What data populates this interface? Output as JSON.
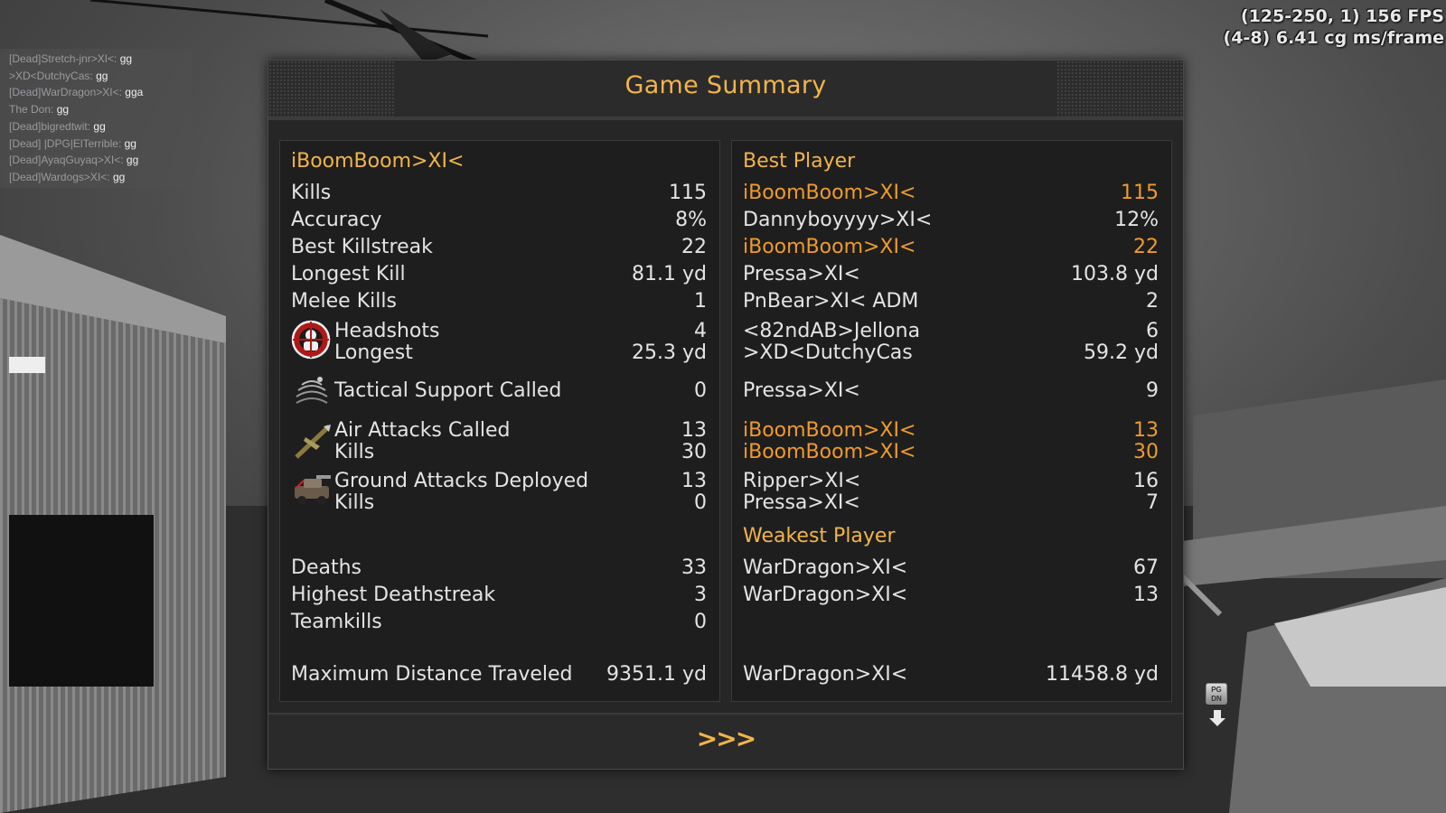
{
  "chat": [
    {
      "prefix": "[Dead]Stretch-jnr>XI<:",
      "msg": "gg"
    },
    {
      "prefix": ">XD<DutchyCas:",
      "msg": "gg"
    },
    {
      "prefix": "[Dead]WarDragon>XI<:",
      "msg": "gga"
    },
    {
      "prefix": "The Don:",
      "msg": "gg"
    },
    {
      "prefix": "[Dead]bigredtwit:",
      "msg": "gg"
    },
    {
      "prefix": "[Dead] |DPG|ElTerrible:",
      "msg": "gg"
    },
    {
      "prefix": "[Dead]AyaqGuyaq>XI<:",
      "msg": "gg"
    },
    {
      "prefix": "[Dead]Wardogs>XI<:",
      "msg": "gg"
    }
  ],
  "perf": {
    "line1": "(125-250, 1) 156 FPS",
    "line2": "(4-8) 6.41 cg ms/frame"
  },
  "hint": {
    "key": "PG DN",
    "icon": "down-arrow-icon"
  },
  "dialog": {
    "title": "Game Summary",
    "next_label": ">>>",
    "left": {
      "player": "iBoomBoom>XI<",
      "kills": {
        "label": "Kills",
        "value": "115"
      },
      "accuracy": {
        "label": "Accuracy",
        "value": "8%"
      },
      "best_killstreak": {
        "label": "Best Killstreak",
        "value": "22"
      },
      "longest_kill": {
        "label": "Longest Kill",
        "value": "81.1 yd"
      },
      "melee": {
        "label": "Melee Kills",
        "value": "1"
      },
      "headshots": {
        "label": "Headshots",
        "value": "4"
      },
      "headshot_longest": {
        "label": "Longest",
        "value": "25.3 yd"
      },
      "tactical": {
        "label": "Tactical Support Called",
        "value": "0"
      },
      "air": {
        "label": "Air Attacks Called",
        "value": "13"
      },
      "air_kills": {
        "label": "Kills",
        "value": "30"
      },
      "ground": {
        "label": "Ground Attacks Deployed",
        "value": "13"
      },
      "ground_kills": {
        "label": "Kills",
        "value": "0"
      },
      "deaths": {
        "label": "Deaths",
        "value": "33"
      },
      "deathstreak": {
        "label": "Highest Deathstreak",
        "value": "3"
      },
      "teamkills": {
        "label": "Teamkills",
        "value": "0"
      },
      "distance": {
        "label": "Maximum Distance Traveled",
        "value": "9351.1 yd"
      }
    },
    "right": {
      "best_header": "Best Player",
      "weakest_header": "Weakest Player",
      "kills": {
        "name": "iBoomBoom>XI<",
        "value": "115"
      },
      "accuracy": {
        "name": "Dannyboyyyy>XI<",
        "value": "12%"
      },
      "best_killstreak": {
        "name": "iBoomBoom>XI<",
        "value": "22"
      },
      "longest_kill": {
        "name": "Pressa>XI<",
        "value": "103.8 yd"
      },
      "melee": {
        "name": "PnBear>XI< ADM",
        "value": "2"
      },
      "headshots": {
        "name": "<82ndAB>Jellona",
        "value": "6"
      },
      "headshot_longest": {
        "name": ">XD<DutchyCas",
        "value": "59.2 yd"
      },
      "tactical": {
        "name": "Pressa>XI<",
        "value": "9"
      },
      "air": {
        "name": "iBoomBoom>XI<",
        "value": "13"
      },
      "air_kills": {
        "name": "iBoomBoom>XI<",
        "value": "30"
      },
      "ground": {
        "name": "Ripper>XI<",
        "value": "16"
      },
      "ground_kills": {
        "name": "Pressa>XI<",
        "value": "7"
      },
      "deaths": {
        "name": "WarDragon>XI<",
        "value": "67"
      },
      "deathstreak": {
        "name": "WarDragon>XI<",
        "value": "13"
      },
      "distance": {
        "name": "WarDragon>XI<",
        "value": "11458.8 yd"
      }
    },
    "colors": {
      "accent": "#f2b44a",
      "highlight": "#f09a2c",
      "text": "#e4e4e4"
    },
    "icons": [
      "headshot-icon",
      "tactical-support-icon",
      "air-attack-icon",
      "ground-attack-icon"
    ]
  }
}
